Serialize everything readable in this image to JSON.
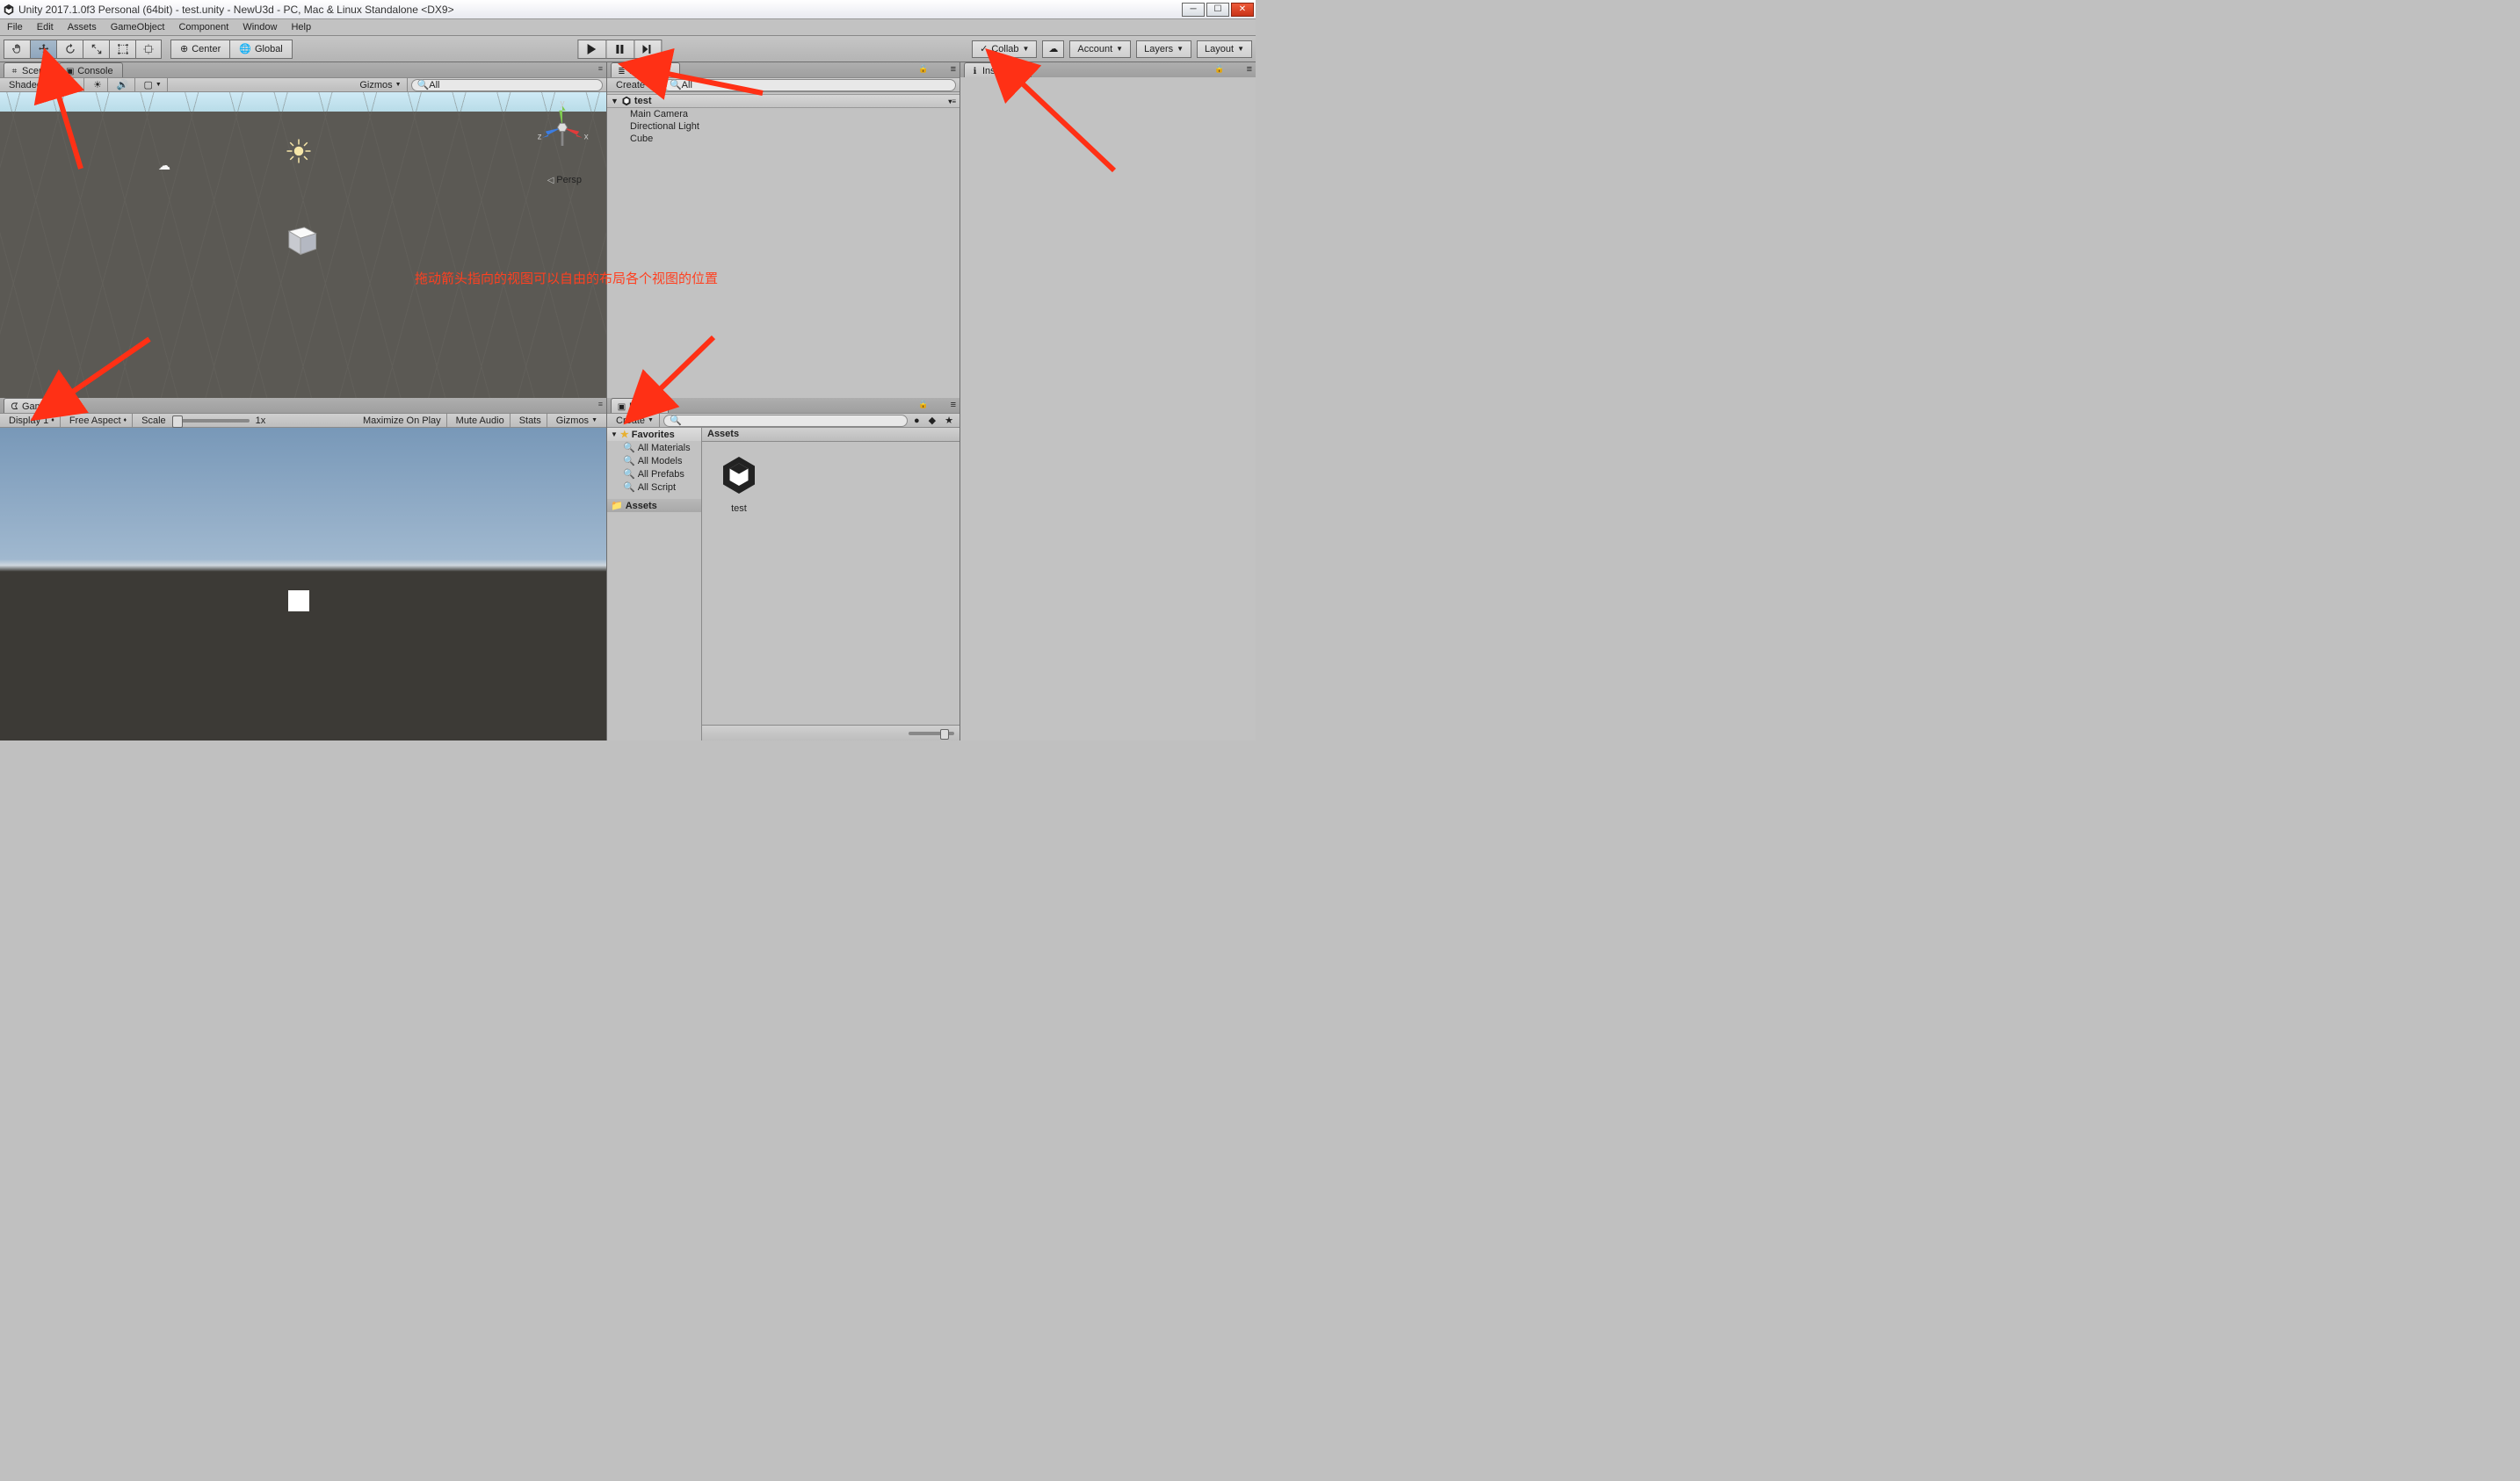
{
  "title": "Unity 2017.1.0f3 Personal (64bit) - test.unity - NewU3d - PC, Mac & Linux Standalone <DX9>",
  "menu": [
    "File",
    "Edit",
    "Assets",
    "GameObject",
    "Component",
    "Window",
    "Help"
  ],
  "toolbar": {
    "center": "Center",
    "global": "Global",
    "collab": "Collab",
    "account": "Account",
    "layers": "Layers",
    "layout": "Layout"
  },
  "scene_tab": "Scene",
  "console_tab": "Console",
  "scene_toolbar": {
    "shaded": "Shaded",
    "twoD": "2D",
    "gizmos": "Gizmos",
    "search_ph": "All"
  },
  "scene_persp": "Persp",
  "game_tab": "Game",
  "game_toolbar": {
    "display": "Display 1",
    "aspect": "Free Aspect",
    "scale_label": "Scale",
    "scale_val": "1x",
    "maximize": "Maximize On Play",
    "mute": "Mute Audio",
    "stats": "Stats",
    "gizmos": "Gizmos"
  },
  "hierarchy_tab": "Hierarchy",
  "hierarchy_toolbar": {
    "create": "Create",
    "search_ph": "All"
  },
  "hierarchy": {
    "scene": "test",
    "items": [
      "Main Camera",
      "Directional Light",
      "Cube"
    ]
  },
  "project_tab": "Project",
  "project_toolbar": {
    "create": "Create"
  },
  "project": {
    "favorites_label": "Favorites",
    "favorites": [
      "All Materials",
      "All Models",
      "All Prefabs",
      "All Script"
    ],
    "assets_folder": "Assets",
    "breadcrumb": "Assets",
    "assets": [
      "test"
    ]
  },
  "inspector_tab": "Inspector",
  "annotation": "拖动箭头指向的视图可以自由的布局各个视图的位置"
}
